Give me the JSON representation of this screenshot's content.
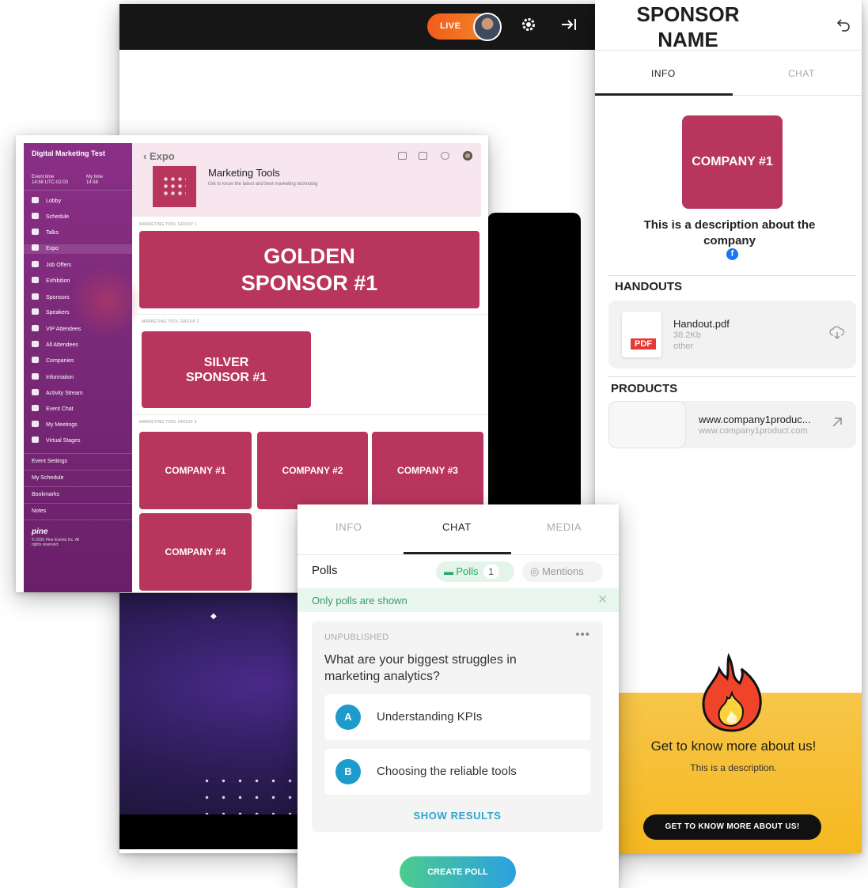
{
  "stage": {
    "live_label": "LIVE",
    "settings_icon": "gear-icon",
    "collapse_icon": "arrow-right-to-line-icon"
  },
  "sponsor": {
    "title": "SPONSOR NAME",
    "back_icon": "undo-arrow-icon",
    "tabs": [
      {
        "label": "INFO",
        "active": true
      },
      {
        "label": "CHAT",
        "active": false
      }
    ],
    "logo_text": "COMPANY #1",
    "description": "This is a description about the company",
    "social_icon": "facebook-icon",
    "handouts_heading": "HANDOUTS",
    "handout": {
      "name": "Handout.pdf",
      "size": "38.2Kb",
      "type": "other",
      "badge": "PDF"
    },
    "products_heading": "PRODUCTS",
    "product": {
      "name": "www.company1produc...",
      "url": "www.company1product.com"
    },
    "promo": {
      "title": "Get to know more about us!",
      "description": "This is a description.",
      "button": "GET TO KNOW MORE ABOUT US!",
      "color": "#f5b820"
    }
  },
  "expo": {
    "brand": "Digital Marketing Test",
    "event_time_label": "Event time",
    "event_time": "14:58 UTC-02:00",
    "my_time_label": "My time",
    "my_time": "14:58",
    "nav": [
      {
        "label": "Lobby",
        "active": false
      },
      {
        "label": "Schedule",
        "active": false
      },
      {
        "label": "Talks",
        "active": false
      },
      {
        "label": "Expo",
        "active": true
      },
      {
        "label": "Job Offers",
        "active": false
      },
      {
        "label": "Exhibition",
        "active": false
      },
      {
        "label": "Sponsors",
        "active": false
      },
      {
        "label": "Speakers",
        "active": false
      },
      {
        "label": "VIP Attendees",
        "active": false
      },
      {
        "label": "All Attendees",
        "active": false
      },
      {
        "label": "Companies",
        "active": false
      },
      {
        "label": "Information",
        "active": false
      },
      {
        "label": "Activity Stream",
        "active": false
      },
      {
        "label": "Event Chat",
        "active": false
      },
      {
        "label": "My Meetings",
        "active": false
      },
      {
        "label": "Virtual Stages",
        "active": false
      }
    ],
    "secondary_nav": [
      "Event Settings",
      "My Schedule",
      "Bookmarks",
      "Notes"
    ],
    "footer_logo": "pine",
    "footer_copy": "© 2020 Pine Events Inc. All rights reserved.",
    "breadcrumb": "Expo",
    "tool_title": "Marketing Tools",
    "tool_subtitle": "Get to know the latest and best marketing technolog",
    "groups": [
      {
        "label": "MARKETING TOOL GROUP 1",
        "tiles": [
          "GOLDEN SPONSOR #1"
        ]
      },
      {
        "label": "MARKETING TOOL GROUP 2",
        "tiles": [
          "SILVER SPONSOR #1"
        ]
      },
      {
        "label": "MARKETING TOOL GROUP 3",
        "tiles": [
          "COMPANY #1",
          "COMPANY #2",
          "COMPANY #3",
          "COMPANY #4"
        ]
      }
    ],
    "accent_color": "#b8365e",
    "sidebar_color": "#7c2a7a"
  },
  "chat": {
    "tabs": [
      {
        "label": "INFO",
        "active": false
      },
      {
        "label": "CHAT",
        "active": true
      },
      {
        "label": "MEDIA",
        "active": false
      }
    ],
    "section_title": "Polls",
    "filter_polls": "Polls",
    "filter_polls_count": "1",
    "filter_mentions": "Mentions",
    "notice": "Only polls are shown",
    "poll": {
      "status": "UNPUBLISHED",
      "question": "What are your biggest struggles in marketing analytics?",
      "options": [
        {
          "letter": "A",
          "text": "Understanding KPIs"
        },
        {
          "letter": "B",
          "text": "Choosing the reliable tools"
        }
      ],
      "show_results": "SHOW RESULTS"
    },
    "create_button": "CREATE POLL"
  }
}
